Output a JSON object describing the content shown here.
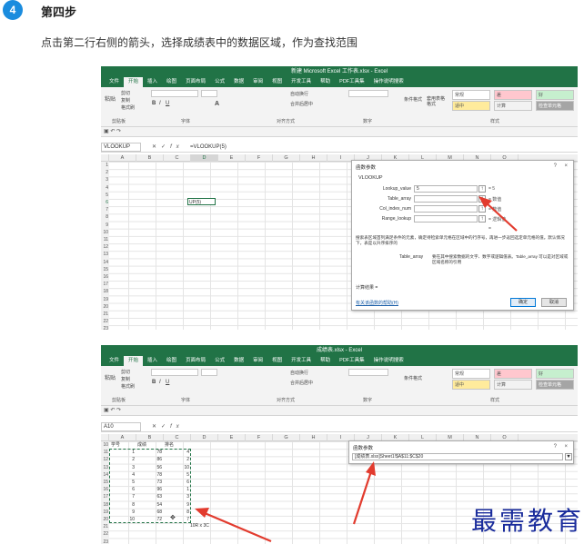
{
  "step": {
    "number": "4",
    "title": "第四步",
    "description": "点击第二行右侧的箭头，选择成绩表中的数据区域，作为查找范围"
  },
  "screenshot1": {
    "window_title": "新建 Microsoft Excel 工作表.xlsx - Excel",
    "menu": [
      "文件",
      "开始",
      "插入",
      "绘图",
      "页面布局",
      "公式",
      "数据",
      "审阅",
      "视图",
      "开发工具",
      "帮助",
      "PDF工具集",
      "操作说明搜索"
    ],
    "active_menu_index": 1,
    "ribbon": {
      "paste": "粘贴",
      "cut": "剪切",
      "copy": "复制",
      "format_painter": "格式刷",
      "clipboard": "剪贴板",
      "font": "字体",
      "alignment": "对齐方式",
      "number": "数字",
      "styles": "样式",
      "wrap": "自动换行",
      "merge": "合并后居中",
      "cond_format": "条件格式",
      "table_format": "套用表格格式",
      "style_normal": "常规",
      "style_bad": "差",
      "style_good": "好",
      "style_neutral": "适中",
      "style_calc": "计算",
      "style_check": "检查单元格"
    },
    "name_box": "VLOOKUP",
    "formula": "=VLOOKUP(5)",
    "columns": [
      "A",
      "B",
      "C",
      "D",
      "E",
      "F",
      "G",
      "H",
      "I",
      "J",
      "K",
      "L",
      "M",
      "N",
      "O"
    ],
    "selected_column": "D",
    "rows": [
      "1",
      "2",
      "3",
      "4",
      "5",
      "6",
      "7",
      "8",
      "9",
      "10",
      "11",
      "12",
      "13",
      "14",
      "15",
      "16",
      "17",
      "18",
      "19",
      "20",
      "21",
      "22",
      "23",
      "24",
      "25",
      "26",
      "27",
      "28",
      "29",
      "30",
      "31",
      "32",
      "33"
    ],
    "active_row": "6",
    "cell_text": "UP(5)",
    "dialog": {
      "title": "函数参数",
      "help": "?",
      "close": "×",
      "function_name": "VLOOKUP",
      "fields": [
        {
          "label": "Lookup_value",
          "value": "5",
          "result": "= 5"
        },
        {
          "label": "Table_array",
          "value": "",
          "result": "= 数值"
        },
        {
          "label": "Col_index_num",
          "value": "",
          "result": "= 数值"
        },
        {
          "label": "Range_lookup",
          "value": "",
          "result": "= 逻辑值"
        }
      ],
      "eq_only": "=",
      "desc": "搜索表区域首列满足条件的元素，确定待检索单元格在区域中的行序号，再进一步返回选定单元格的值。默认情况下，表是以升序排序的",
      "arg_name": "Table_array",
      "arg_desc": "要在其中搜索数据的文字、数字或逻辑值表。Table_array 可以是对区域或区域名称的引用",
      "result_label": "计算结果 =",
      "help_link": "有关该函数的帮助(H)",
      "ok": "确定",
      "cancel": "取消"
    }
  },
  "screenshot2": {
    "window_title": "成绩表.xlsx - Excel",
    "name_box": "A10",
    "columns": [
      "A",
      "B",
      "C",
      "D",
      "E",
      "F",
      "G",
      "H",
      "I",
      "J",
      "K",
      "L",
      "M",
      "N",
      "O"
    ],
    "header_row": {
      "row": "10",
      "a": "学号",
      "b": "成绩",
      "c": "排名"
    },
    "table": [
      [
        "11",
        "1",
        "78",
        "4"
      ],
      [
        "12",
        "2",
        "86",
        "2"
      ],
      [
        "13",
        "3",
        "56",
        "10"
      ],
      [
        "14",
        "4",
        "78",
        "5"
      ],
      [
        "15",
        "5",
        "73",
        "6"
      ],
      [
        "16",
        "6",
        "96",
        "1"
      ],
      [
        "17",
        "7",
        "63",
        "3"
      ],
      [
        "18",
        "8",
        "54",
        "9"
      ],
      [
        "19",
        "9",
        "68",
        "8"
      ],
      [
        "20",
        "10",
        "72",
        "7"
      ]
    ],
    "extra_rows": [
      "21",
      "22",
      "23"
    ],
    "size_tip": "10R x 3C",
    "dialog": {
      "title": "函数参数",
      "help": "?",
      "close": "×",
      "ref": "[成绩表.xlsx]Sheet1!$A$11:$C$20"
    }
  },
  "watermark": "最需教育",
  "colors": {
    "excel_green": "#217346",
    "step_badge": "#1a8cde",
    "arrow": "#e23b2e",
    "watermark": "#1a2c9c"
  }
}
